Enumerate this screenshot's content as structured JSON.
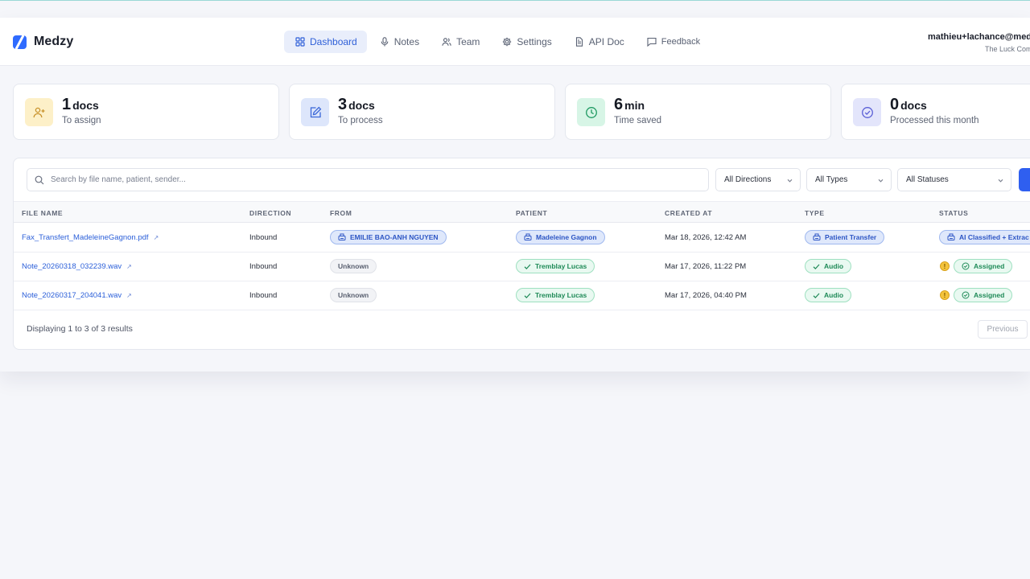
{
  "app": {
    "name": "Medzy"
  },
  "nav": [
    {
      "label": "Dashboard",
      "icon": "grid-icon",
      "active": true
    },
    {
      "label": "Notes",
      "icon": "microphone-icon"
    },
    {
      "label": "Team",
      "icon": "users-icon"
    },
    {
      "label": "Settings",
      "icon": "gear-icon"
    },
    {
      "label": "API Doc",
      "icon": "document-icon"
    },
    {
      "label": "Feedback",
      "icon": "chat-icon"
    }
  ],
  "account": {
    "email": "mathieu+lachance@medz",
    "org": "The Luck Com"
  },
  "stats": [
    {
      "value": "1",
      "unit": "docs",
      "label": "To assign",
      "icon": "user-plus-icon",
      "bg": "#fdf0c8",
      "fg": "#c9922a"
    },
    {
      "value": "3",
      "unit": "docs",
      "label": "To process",
      "icon": "edit-icon",
      "bg": "#dde6fb",
      "fg": "#3a67d8"
    },
    {
      "value": "6",
      "unit": "min",
      "label": "Time saved",
      "icon": "clock-icon",
      "bg": "#d7f5e6",
      "fg": "#1f9a62"
    },
    {
      "value": "0",
      "unit": "docs",
      "label": "Processed this month",
      "icon": "check-circle-icon",
      "bg": "#e3e5fb",
      "fg": "#5a5fd6"
    }
  ],
  "filters": {
    "search_placeholder": "Search by file name, patient, sender...",
    "direction": "All Directions",
    "type": "All Types",
    "status": "All Statuses"
  },
  "columns": [
    "FILE NAME",
    "DIRECTION",
    "FROM",
    "PATIENT",
    "CREATED AT",
    "TYPE",
    "STATUS"
  ],
  "rows": [
    {
      "file": "Fax_Transfert_MadeleineGagnon.pdf",
      "direction": "Inbound",
      "from": "EMILIE BAO-ANH NGUYEN",
      "patient": "Madeleine Gagnon",
      "created": "Mar 18, 2026, 12:42 AM",
      "type": "Patient Transfer",
      "status": "AI Classified + Extrac"
    },
    {
      "file": "Note_20260318_032239.wav",
      "direction": "Inbound",
      "from": "Unknown",
      "patient": "Tremblay Lucas",
      "created": "Mar 17, 2026, 11:22 PM",
      "type": "Audio",
      "status": "Assigned",
      "warn": "!"
    },
    {
      "file": "Note_20260317_204041.wav",
      "direction": "Inbound",
      "from": "Unknown",
      "patient": "Tremblay Lucas",
      "created": "Mar 17, 2026, 04:40 PM",
      "type": "Audio",
      "status": "Assigned",
      "warn": "!"
    }
  ],
  "footer": {
    "summary": "Displaying 1 to 3 of 3 results",
    "previous": "Previous"
  }
}
